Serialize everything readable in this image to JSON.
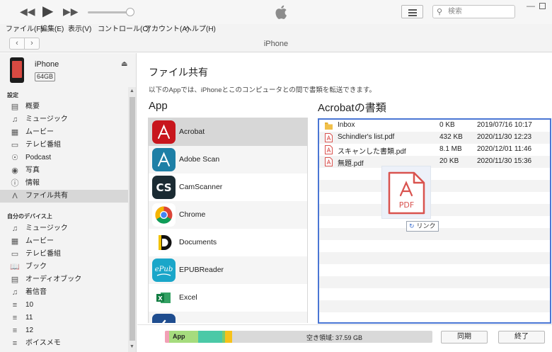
{
  "search": {
    "placeholder": "検索"
  },
  "menu": [
    "ファイル(F)",
    "編集(E)",
    "表示(V)",
    "コントロール(C)",
    "アカウント(A)",
    "ヘルプ(H)"
  ],
  "nav": {
    "title": "iPhone"
  },
  "device": {
    "name": "iPhone",
    "capacity": "64GB"
  },
  "sidebar": {
    "settings_header": "設定",
    "settings": [
      {
        "label": "概要",
        "icon": "summary-icon"
      },
      {
        "label": "ミュージック",
        "icon": "music-note-icon"
      },
      {
        "label": "ムービー",
        "icon": "film-icon"
      },
      {
        "label": "テレビ番組",
        "icon": "tv-icon"
      },
      {
        "label": "Podcast",
        "icon": "podcast-icon"
      },
      {
        "label": "写真",
        "icon": "camera-icon"
      },
      {
        "label": "情報",
        "icon": "info-icon"
      },
      {
        "label": "ファイル共有",
        "icon": "app-store-icon"
      }
    ],
    "device_header": "自分のデバイス上",
    "on_device": [
      {
        "label": "ミュージック",
        "icon": "music-note-icon"
      },
      {
        "label": "ムービー",
        "icon": "film-icon"
      },
      {
        "label": "テレビ番組",
        "icon": "tv-icon"
      },
      {
        "label": "ブック",
        "icon": "book-icon"
      },
      {
        "label": "オーディオブック",
        "icon": "audiobook-icon"
      },
      {
        "label": "着信音",
        "icon": "bell-icon"
      },
      {
        "label": "10",
        "icon": "playlist-icon"
      },
      {
        "label": "11",
        "icon": "playlist-icon"
      },
      {
        "label": "12",
        "icon": "playlist-icon"
      },
      {
        "label": "ボイスメモ",
        "icon": "playlist-icon"
      }
    ]
  },
  "main": {
    "title": "ファイル共有",
    "description": "以下のAppでは、iPhoneとこのコンピュータとの間で書類を転送できます。",
    "apps_header": "App",
    "docs_header": "Acrobatの書類",
    "apps": [
      "Acrobat",
      "Adobe Scan",
      "CamScanner",
      "Chrome",
      "Documents",
      "EPUBReader",
      "Excel"
    ],
    "files": [
      {
        "name": "Inbox",
        "size": "0 KB",
        "date": "2019/07/16 10:17",
        "type": "folder"
      },
      {
        "name": "Schindler's list.pdf",
        "size": "432 KB",
        "date": "2020/11/30 12:23",
        "type": "pdf"
      },
      {
        "name": "スキャンした書類.pdf",
        "size": "8.1 MB",
        "date": "2020/12/01 11:46",
        "type": "pdf"
      },
      {
        "name": "無題.pdf",
        "size": "20 KB",
        "date": "2020/11/30 15:36",
        "type": "pdf"
      }
    ],
    "drag_label": "PDF",
    "drag_tooltip": "リンク"
  },
  "bottom": {
    "app_label": "App",
    "free_space": "空き領域: 37.59 GB",
    "sync_label": "同期",
    "done_label": "終了"
  },
  "colors": {
    "accent": "#4a76d4",
    "pdf_red": "#d9534f",
    "storage_app": "#a6dc7e"
  }
}
